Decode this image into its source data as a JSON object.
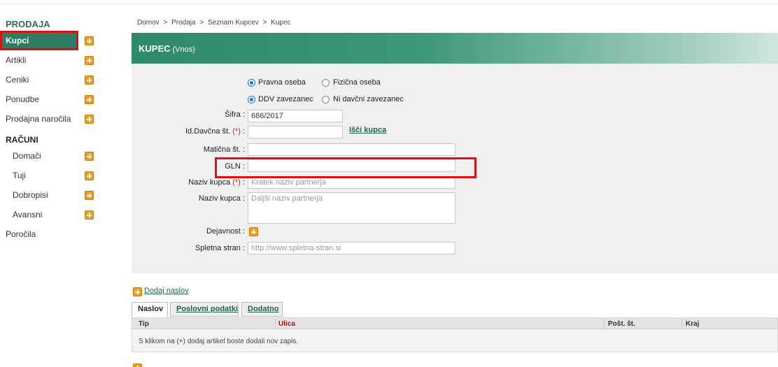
{
  "sidebar": {
    "section1": "PRODAJA",
    "items1": [
      {
        "label": "Kupci",
        "active": true
      },
      {
        "label": "Artikli"
      },
      {
        "label": "Ceniki"
      },
      {
        "label": "Ponudbe"
      },
      {
        "label": "Prodajna naročila"
      }
    ],
    "section2": "RAČUNI",
    "items2": [
      {
        "label": "Domači"
      },
      {
        "label": "Tuji"
      },
      {
        "label": "Dobropisi"
      },
      {
        "label": "Avansni"
      }
    ],
    "reports": "Poročila"
  },
  "breadcrumb": [
    "Domov",
    ">",
    "Prodaja",
    ">",
    "Seznam Kupcev",
    ">",
    "Kupec"
  ],
  "header": {
    "title": "KUPEC",
    "subtitle": "(Vnos)"
  },
  "form": {
    "radio_pravna": "Pravna oseba",
    "radio_fizicna": "Fizična oseba",
    "radio_ddv": "DDV zavezanec",
    "radio_niddv": "Ni davčni zavezanec",
    "sifra_label": "Šifra",
    "sifra_value": "686/2017",
    "idddv_label": "Id.Davčna št.",
    "required_mark": "(*)",
    "colon": ":",
    "isci_link": "Išči kupca",
    "maticna_label": "Matična št.",
    "gln_label": "GLN",
    "naziv_label": "Naziv kupca",
    "naziv_placeholder": "Kratek naziv partnerja",
    "naziv2_label": "Naziv kupca",
    "naziv2_placeholder": "Daljši naziv partnerja",
    "dejavnost_label": "Dejavnost",
    "spletna_label": "Spletna stran",
    "spletna_placeholder": "http://www.spletna-stran.si"
  },
  "address": {
    "add_label": "Dodaj naslov",
    "tabs": [
      "Naslov",
      "Poslovni podatki",
      "Dodatno"
    ],
    "columns": [
      "Tip",
      "Ulica",
      "Pošt. št.",
      "Kraj"
    ],
    "empty_message": "S klikom na (+) dodaj artikel boste dodali nov zapis."
  },
  "colors": {
    "accent": "#2e7d62",
    "highlight": "#e01010"
  }
}
